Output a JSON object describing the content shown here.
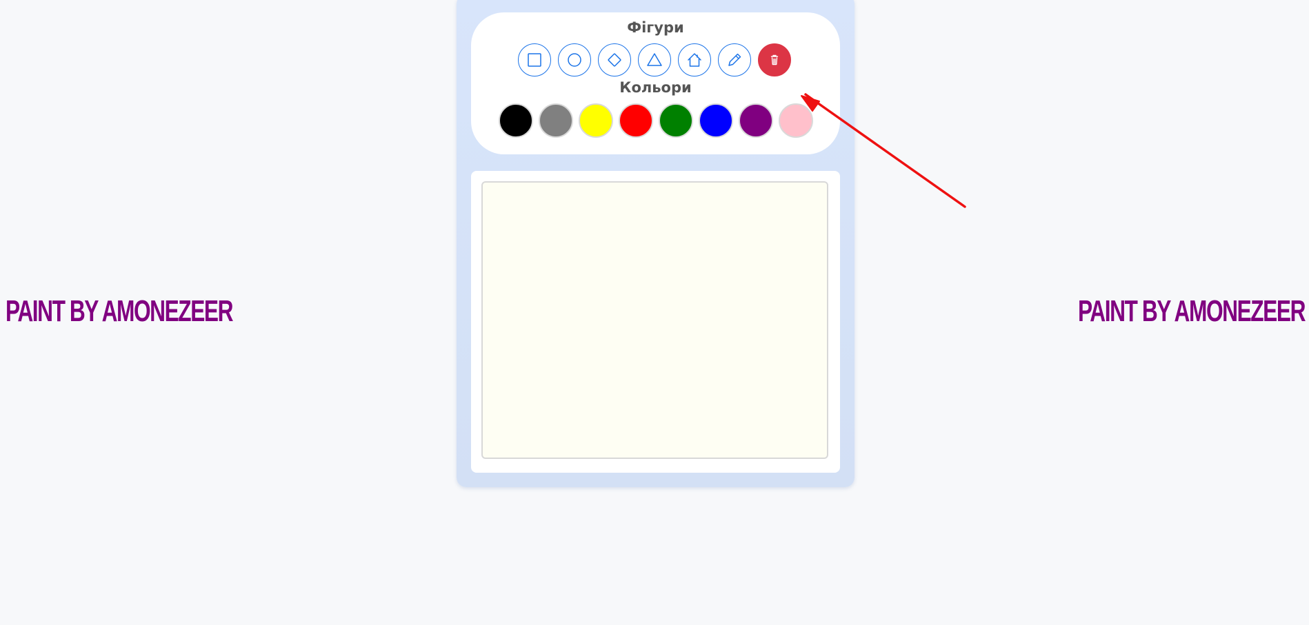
{
  "side_titles": {
    "left": "PAINT BY AMONEZEER",
    "right": "PAINT BY AMONEZEER"
  },
  "toolbar": {
    "shapes_label": "Фігури",
    "colors_label": "Кольори",
    "shapes": [
      {
        "name": "square",
        "icon": "square-icon"
      },
      {
        "name": "circle",
        "icon": "circle-icon"
      },
      {
        "name": "diamond",
        "icon": "diamond-icon"
      },
      {
        "name": "triangle",
        "icon": "triangle-icon"
      },
      {
        "name": "house",
        "icon": "house-icon"
      },
      {
        "name": "pencil",
        "icon": "pencil-icon"
      },
      {
        "name": "delete",
        "icon": "trash-icon"
      }
    ],
    "colors": [
      {
        "name": "black",
        "hex": "#000000"
      },
      {
        "name": "gray",
        "hex": "#808080"
      },
      {
        "name": "yellow",
        "hex": "#ffff00"
      },
      {
        "name": "red",
        "hex": "#ff0000"
      },
      {
        "name": "green",
        "hex": "#008000"
      },
      {
        "name": "blue",
        "hex": "#0000ff"
      },
      {
        "name": "purple",
        "hex": "#800080"
      },
      {
        "name": "pink",
        "hex": "#ffc0cb"
      }
    ]
  },
  "colors": {
    "accent": "#1a73e8",
    "delete": "#dc3545",
    "title": "#800080",
    "arrow": "#ee1111",
    "canvas_bg": "#fefef3"
  }
}
